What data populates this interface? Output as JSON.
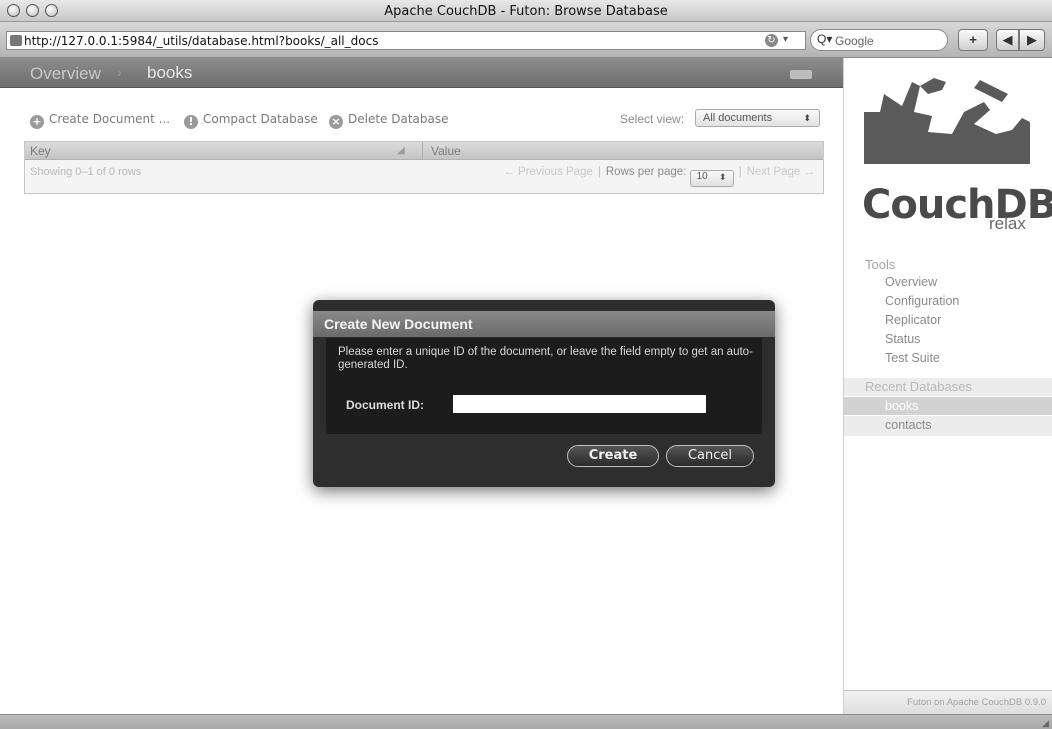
{
  "window": {
    "title": "Apache CouchDB - Futon: Browse Database"
  },
  "toolbar": {
    "url": "http://127.0.0.1:5984/_utils/database.html?books/_all_docs",
    "search_placeholder": "Google",
    "plus_label": "+",
    "back_label": "◀",
    "forward_label": "▶"
  },
  "breadcrumb": {
    "overview": "Overview",
    "separator": "›",
    "current": "books"
  },
  "actions": {
    "create": "Create Document ...",
    "compact": "Compact Database",
    "delete": "Delete Database"
  },
  "view_selector": {
    "label": "Select view:",
    "selected": "All documents"
  },
  "grid": {
    "columns": [
      "Key",
      "Value"
    ],
    "status": "Showing 0–1 of 0 rows",
    "previous": "← Previous Page",
    "rows_label": "Rows per page:",
    "rows_value": "10",
    "next": "Next Page →"
  },
  "dialog": {
    "title": "Create New Document",
    "message": "Please enter a unique ID of the document, or leave the field empty to get an auto-generated ID.",
    "field_label": "Document ID:",
    "field_value": "",
    "create_label": "Create",
    "cancel_label": "Cancel"
  },
  "sidebar": {
    "logo_text": "CouchDB",
    "logo_tagline": "relax",
    "tools_heading": "Tools",
    "tools": [
      "Overview",
      "Configuration",
      "Replicator",
      "Status",
      "Test Suite"
    ],
    "recent_heading": "Recent Databases",
    "recent": [
      "books",
      "contacts"
    ],
    "footer": "Futon on Apache CouchDB 0.9.0"
  },
  "icons": {
    "create": "plus-circle-icon",
    "compact": "compact-circle-icon",
    "delete": "x-circle-icon"
  }
}
